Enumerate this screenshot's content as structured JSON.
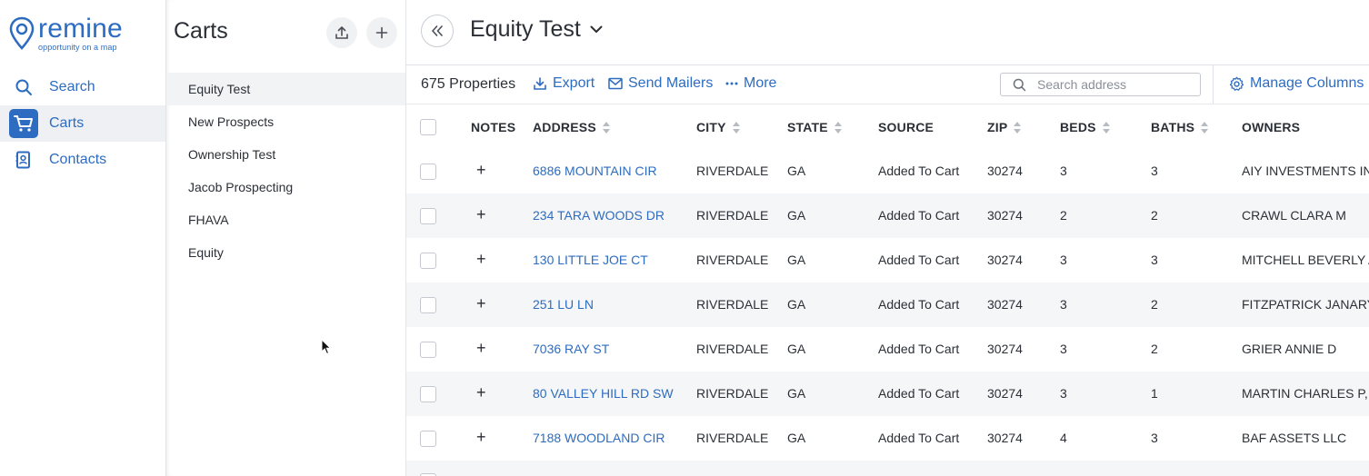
{
  "logo": {
    "name": "remine",
    "tagline": "opportunity on a map"
  },
  "nav": {
    "items": [
      {
        "label": "Search"
      },
      {
        "label": "Carts"
      },
      {
        "label": "Contacts"
      }
    ]
  },
  "carts_panel": {
    "title": "Carts",
    "items": [
      {
        "label": "Equity Test"
      },
      {
        "label": "New Prospects"
      },
      {
        "label": "Ownership Test"
      },
      {
        "label": "Jacob Prospecting"
      },
      {
        "label": "FHAVA"
      },
      {
        "label": "Equity"
      }
    ]
  },
  "header": {
    "cart_name": "Equity Test"
  },
  "toolbar": {
    "property_count": "675 Properties",
    "export_label": "Export",
    "send_mailers_label": "Send Mailers",
    "more_label": "More",
    "search_placeholder": "Search address",
    "manage_columns_label": "Manage Columns"
  },
  "table": {
    "columns": {
      "notes": "NOTES",
      "address": "ADDRESS",
      "city": "CITY",
      "state": "STATE",
      "source": "SOURCE",
      "zip": "ZIP",
      "beds": "BEDS",
      "baths": "BATHS",
      "owners": "OWNERS"
    },
    "rows": [
      {
        "address": "6886 MOUNTAIN CIR",
        "city": "RIVERDALE",
        "state": "GA",
        "source": "Added To Cart",
        "zip": "30274",
        "beds": "3",
        "baths": "3",
        "owners": "AIY INVESTMENTS INC"
      },
      {
        "address": "234 TARA WOODS DR",
        "city": "RIVERDALE",
        "state": "GA",
        "source": "Added To Cart",
        "zip": "30274",
        "beds": "2",
        "baths": "2",
        "owners": "CRAWL CLARA M"
      },
      {
        "address": "130 LITTLE JOE CT",
        "city": "RIVERDALE",
        "state": "GA",
        "source": "Added To Cart",
        "zip": "30274",
        "beds": "3",
        "baths": "3",
        "owners": "MITCHELL BEVERLY A,"
      },
      {
        "address": "251 LU LN",
        "city": "RIVERDALE",
        "state": "GA",
        "source": "Added To Cart",
        "zip": "30274",
        "beds": "3",
        "baths": "2",
        "owners": "FITZPATRICK JANARY A"
      },
      {
        "address": "7036 RAY ST",
        "city": "RIVERDALE",
        "state": "GA",
        "source": "Added To Cart",
        "zip": "30274",
        "beds": "3",
        "baths": "2",
        "owners": "GRIER ANNIE D"
      },
      {
        "address": "80 VALLEY HILL RD SW",
        "city": "RIVERDALE",
        "state": "GA",
        "source": "Added To Cart",
        "zip": "30274",
        "beds": "3",
        "baths": "1",
        "owners": "MARTIN CHARLES P, M"
      },
      {
        "address": "7188 WOODLAND CIR",
        "city": "RIVERDALE",
        "state": "GA",
        "source": "Added To Cart",
        "zip": "30274",
        "beds": "4",
        "baths": "3",
        "owners": "BAF ASSETS LLC"
      }
    ]
  },
  "colors": {
    "accent": "#2d6cc0",
    "text": "#2b2f36",
    "row_alt": "#f5f6f8",
    "border": "#dfe2e6"
  }
}
